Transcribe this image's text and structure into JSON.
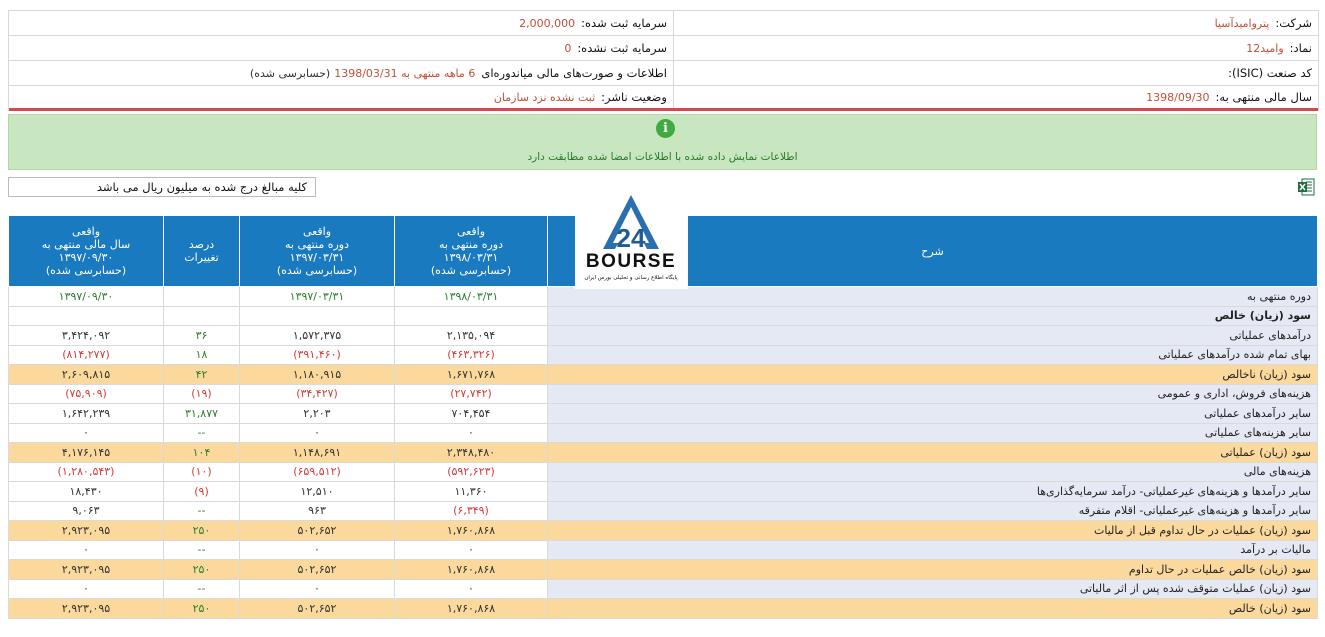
{
  "header": {
    "rows": [
      {
        "right_label": "شرکت:",
        "right_value": "پتروامیدآسیا",
        "left_label": "سرمایه ثبت شده:",
        "left_value": "2,000,000"
      },
      {
        "right_label": "نماد:",
        "right_value": "وامید12",
        "left_label": "سرمایه ثبت نشده:",
        "left_value": "0"
      },
      {
        "right_label": "کد صنعت (ISIC):",
        "right_value": "",
        "left_label": "اطلاعات و صورت‌های مالی میاندوره‌ای",
        "left_value": "6 ماهه منتهی به 1398/03/31",
        "left_suffix": "(حسابرسی شده)"
      },
      {
        "right_label": "سال مالی منتهی به:",
        "right_value": "1398/09/30",
        "left_label": "وضعیت ناشر:",
        "left_value": "ثبت نشده نزد سازمان"
      }
    ]
  },
  "notice": {
    "icon": "info-icon",
    "text": "اطلاعات نمایش داده شده با اطلاعات امضا شده مطابقت دارد"
  },
  "unit_note": "کلیه مبالغ درج شده به میلیون ریال می باشد",
  "logo": {
    "text": "BOURSE",
    "number": "24",
    "subtitle": "پایگاه اطلاع رسانی و تحلیلی بورس ایران"
  },
  "colors": {
    "header_blue": "#1a7ac0",
    "highlight_row": "#fbd99c",
    "desc_bg": "#e4e9f4",
    "positive": "#2f7d2f",
    "negative": "#d23c3c",
    "notice_bg": "#c8e6c0"
  },
  "table": {
    "columns": [
      {
        "line1": "واقعی",
        "line2": "سال مالی منتهی به",
        "line3": "۱۳۹۷/۰۹/۳۰",
        "line4": "(حسابرسی شده)"
      },
      {
        "line1": "درصد",
        "line2": "تغییرات",
        "line3": "",
        "line4": ""
      },
      {
        "line1": "واقعی",
        "line2": "دوره منتهی به",
        "line3": "۱۳۹۷/۰۳/۳۱",
        "line4": "(حسابرسی شده)"
      },
      {
        "line1": "واقعی",
        "line2": "دوره منتهی به",
        "line3": "۱۳۹۸/۰۳/۳۱",
        "line4": "(حسابرسی شده)"
      },
      {
        "line1": "",
        "line2": "",
        "line3": "",
        "line4": ""
      },
      {
        "line1": "شرح",
        "line2": "",
        "line3": "",
        "line4": ""
      }
    ],
    "rows": [
      {
        "desc": "دوره منتهی به",
        "fy": "۱۳۹۷/۰۹/۳۰",
        "pct": "",
        "p97": "۱۳۹۷/۰۳/۳۱",
        "p98": "۱۳۹۸/۰۳/۳۱",
        "hl": false,
        "bold": false,
        "fyc": "g",
        "pc": "g",
        "c97": "g",
        "c98": "g"
      },
      {
        "desc": "سود (زیان) خالص",
        "fy": "",
        "pct": "",
        "p97": "",
        "p98": "",
        "hl": false,
        "bold": true,
        "fyc": "k",
        "pc": "k",
        "c97": "k",
        "c98": "k"
      },
      {
        "desc": "درآمدهای عملیاتی",
        "fy": "۳,۴۲۴,۰۹۲",
        "pct": "۳۶",
        "p97": "۱,۵۷۲,۳۷۵",
        "p98": "۲,۱۳۵,۰۹۴",
        "hl": false,
        "bold": false,
        "fyc": "k",
        "pc": "g",
        "c97": "k",
        "c98": "k"
      },
      {
        "desc": "بهای تمام شده درآمدهای عملیاتی",
        "fy": "(۸۱۴,۲۷۷)",
        "pct": "۱۸",
        "p97": "(۳۹۱,۴۶۰)",
        "p98": "(۴۶۳,۳۲۶)",
        "hl": false,
        "bold": false,
        "fyc": "r",
        "pc": "g",
        "c97": "r",
        "c98": "r"
      },
      {
        "desc": "سود (زیان) ناخالص",
        "fy": "۲,۶۰۹,۸۱۵",
        "pct": "۴۲",
        "p97": "۱,۱۸۰,۹۱۵",
        "p98": "۱,۶۷۱,۷۶۸",
        "hl": true,
        "bold": false,
        "fyc": "k",
        "pc": "g",
        "c97": "k",
        "c98": "k"
      },
      {
        "desc": "هزینه‌های فروش، اداری و عمومی",
        "fy": "(۷۵,۹۰۹)",
        "pct": "(۱۹)",
        "p97": "(۳۴,۴۲۷)",
        "p98": "(۲۷,۷۴۲)",
        "hl": false,
        "bold": false,
        "fyc": "r",
        "pc": "r",
        "c97": "r",
        "c98": "r"
      },
      {
        "desc": "سایر درآمدهای عملیاتی",
        "fy": "۱,۶۴۲,۲۳۹",
        "pct": "۳۱,۸۷۷",
        "p97": "۲,۲۰۳",
        "p98": "۷۰۴,۴۵۴",
        "hl": false,
        "bold": false,
        "fyc": "k",
        "pc": "g",
        "c97": "k",
        "c98": "k"
      },
      {
        "desc": "سایر هزینه‌های عملیاتی",
        "fy": "۰",
        "pct": "--",
        "p97": "۰",
        "p98": "۰",
        "hl": false,
        "bold": false,
        "fyc": "k",
        "pc": "g",
        "c97": "k",
        "c98": "k"
      },
      {
        "desc": "سود (زیان) عملیاتی",
        "fy": "۴,۱۷۶,۱۴۵",
        "pct": "۱۰۴",
        "p97": "۱,۱۴۸,۶۹۱",
        "p98": "۲,۳۴۸,۴۸۰",
        "hl": true,
        "bold": false,
        "fyc": "k",
        "pc": "g",
        "c97": "k",
        "c98": "k"
      },
      {
        "desc": "هزینه‌های مالی",
        "fy": "(۱,۲۸۰,۵۴۳)",
        "pct": "(۱۰)",
        "p97": "(۶۵۹,۵۱۲)",
        "p98": "(۵۹۲,۶۲۳)",
        "hl": false,
        "bold": false,
        "fyc": "r",
        "pc": "r",
        "c97": "r",
        "c98": "r"
      },
      {
        "desc": "سایر درآمدها و هزینه‌های غیرعملیاتی- درآمد سرمایه‌گذاری‌ها",
        "fy": "۱۸,۴۳۰",
        "pct": "(۹)",
        "p97": "۱۲,۵۱۰",
        "p98": "۱۱,۳۶۰",
        "hl": false,
        "bold": false,
        "fyc": "k",
        "pc": "r",
        "c97": "k",
        "c98": "k"
      },
      {
        "desc": "سایر درآمدها و هزینه‌های غیرعملیاتی- اقلام متفرقه",
        "fy": "۹,۰۶۳",
        "pct": "--",
        "p97": "۹۶۳",
        "p98": "(۶,۳۴۹)",
        "hl": false,
        "bold": false,
        "fyc": "k",
        "pc": "g",
        "c97": "k",
        "c98": "r"
      },
      {
        "desc": "سود (زیان) عملیات در حال تداوم قبل از مالیات",
        "fy": "۲,۹۲۳,۰۹۵",
        "pct": "۲۵۰",
        "p97": "۵۰۲,۶۵۲",
        "p98": "۱,۷۶۰,۸۶۸",
        "hl": true,
        "bold": false,
        "fyc": "k",
        "pc": "g",
        "c97": "k",
        "c98": "k"
      },
      {
        "desc": "مالیات بر درآمد",
        "fy": "۰",
        "pct": "--",
        "p97": "۰",
        "p98": "۰",
        "hl": false,
        "bold": false,
        "fyc": "k",
        "pc": "g",
        "c97": "k",
        "c98": "k"
      },
      {
        "desc": "سود (زیان) خالص عملیات در حال تداوم",
        "fy": "۲,۹۲۳,۰۹۵",
        "pct": "۲۵۰",
        "p97": "۵۰۲,۶۵۲",
        "p98": "۱,۷۶۰,۸۶۸",
        "hl": true,
        "bold": false,
        "fyc": "k",
        "pc": "g",
        "c97": "k",
        "c98": "k"
      },
      {
        "desc": "سود (زیان) عملیات متوقف شده پس از اثر مالیاتی",
        "fy": "۰",
        "pct": "--",
        "p97": "۰",
        "p98": "۰",
        "hl": false,
        "bold": false,
        "fyc": "k",
        "pc": "g",
        "c97": "k",
        "c98": "k"
      },
      {
        "desc": "سود (زیان) خالص",
        "fy": "۲,۹۲۳,۰۹۵",
        "pct": "۲۵۰",
        "p97": "۵۰۲,۶۵۲",
        "p98": "۱,۷۶۰,۸۶۸",
        "hl": true,
        "bold": false,
        "fyc": "k",
        "pc": "g",
        "c97": "k",
        "c98": "k"
      }
    ]
  }
}
